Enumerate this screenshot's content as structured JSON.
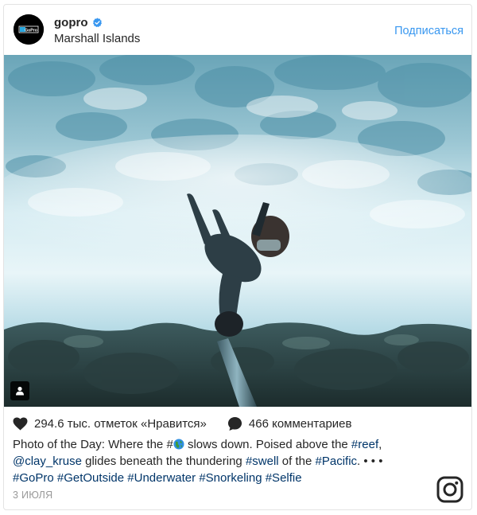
{
  "header": {
    "username": "gopro",
    "location": "Marshall Islands",
    "follow_label": "Подписаться",
    "avatar_text": "GoPro",
    "verified_icon": "verified-badge-icon"
  },
  "post": {
    "likes_text": "294.6 тыс. отметок «Нравится»",
    "comments_text": "466 комментариев",
    "caption": {
      "line1_a": "Photo of the Day: Where the #",
      "line1_b": " slows down. Poised above the ",
      "tag_reef": "#reef",
      "line1_c": ",",
      "mention": "@clay_kruse",
      "line2_a": " glides beneath the thundering ",
      "tag_swell": "#swell",
      "line2_b": " of the ",
      "tag_pacific": "#Pacific",
      "line2_c": ". • • •",
      "hashtags": [
        "#GoPro",
        "#GetOutside",
        "#Underwater",
        "#Snorkeling",
        "#Selfie"
      ]
    },
    "date": "3 ИЮЛЯ"
  },
  "colors": {
    "accent": "#3897f0",
    "link": "#003569",
    "muted": "#999999",
    "text": "#262626"
  }
}
